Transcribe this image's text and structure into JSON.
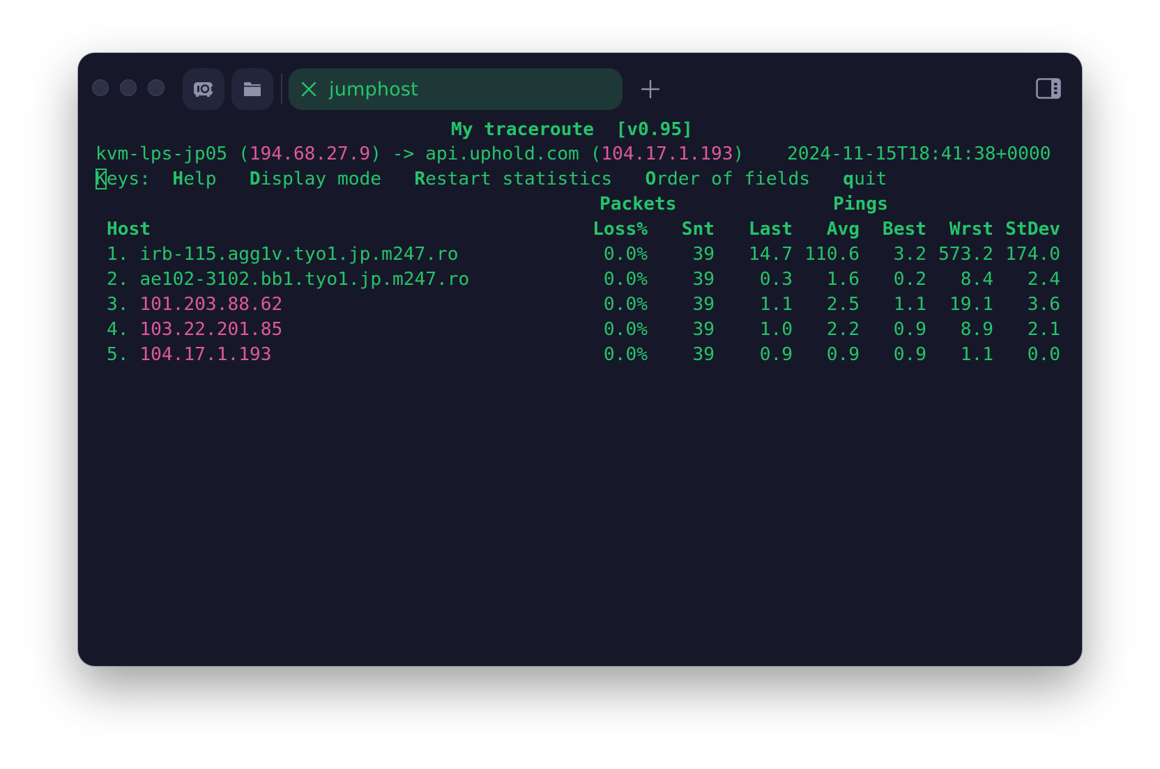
{
  "window": {
    "traffic_lights": [
      "close",
      "minimize",
      "maximize"
    ],
    "toolbar": {
      "screenshot_icon": "camera-icon",
      "files_icon": "folder-icon",
      "new_tab_icon": "plus-icon",
      "sidebar_icon": "sidebar-toggle-icon"
    },
    "tab": {
      "title": "jumphost",
      "close_icon": "close-icon",
      "active": true
    }
  },
  "colors": {
    "background": "#161829",
    "text_green": "#25c46a",
    "ip_pink": "#e0589c",
    "tab_bg": "#1e3838"
  },
  "mtr": {
    "title": "My traceroute",
    "version": "[v0.95]",
    "source_host": "kvm-lps-jp05",
    "source_ip": "194.68.27.9",
    "arrow": "->",
    "dest_host": "api.uphold.com",
    "dest_ip": "104.17.1.193",
    "timestamp": "2024-11-15T18:41:38+0000",
    "keys": {
      "label": "Keys:",
      "items": [
        {
          "key": "H",
          "rest": "elp"
        },
        {
          "key": "D",
          "rest": "isplay mode"
        },
        {
          "key": "R",
          "rest": "estart statistics"
        },
        {
          "key": "O",
          "rest": "rder of fields"
        },
        {
          "key": "q",
          "rest": "uit"
        }
      ]
    },
    "group_headers": {
      "packets": "Packets",
      "pings": "Pings"
    },
    "columns": [
      "Host",
      "Loss%",
      "Snt",
      "Last",
      "Avg",
      "Best",
      "Wrst",
      "StDev"
    ],
    "hops": [
      {
        "n": "1.",
        "host": "irb-115.agg1v.tyo1.jp.m247.ro",
        "is_ip": false,
        "loss": "0.0%",
        "snt": "39",
        "last": "14.7",
        "avg": "110.6",
        "best": "3.2",
        "wrst": "573.2",
        "stdev": "174.0"
      },
      {
        "n": "2.",
        "host": "ae102-3102.bb1.tyo1.jp.m247.ro",
        "is_ip": false,
        "loss": "0.0%",
        "snt": "39",
        "last": "0.3",
        "avg": "1.6",
        "best": "0.2",
        "wrst": "8.4",
        "stdev": "2.4"
      },
      {
        "n": "3.",
        "host": "101.203.88.62",
        "is_ip": true,
        "loss": "0.0%",
        "snt": "39",
        "last": "1.1",
        "avg": "2.5",
        "best": "1.1",
        "wrst": "19.1",
        "stdev": "3.6"
      },
      {
        "n": "4.",
        "host": "103.22.201.85",
        "is_ip": true,
        "loss": "0.0%",
        "snt": "39",
        "last": "1.0",
        "avg": "2.2",
        "best": "0.9",
        "wrst": "8.9",
        "stdev": "2.1"
      },
      {
        "n": "5.",
        "host": "104.17.1.193",
        "is_ip": true,
        "loss": "0.0%",
        "snt": "39",
        "last": "0.9",
        "avg": "0.9",
        "best": "0.9",
        "wrst": "1.1",
        "stdev": "0.0"
      }
    ]
  }
}
